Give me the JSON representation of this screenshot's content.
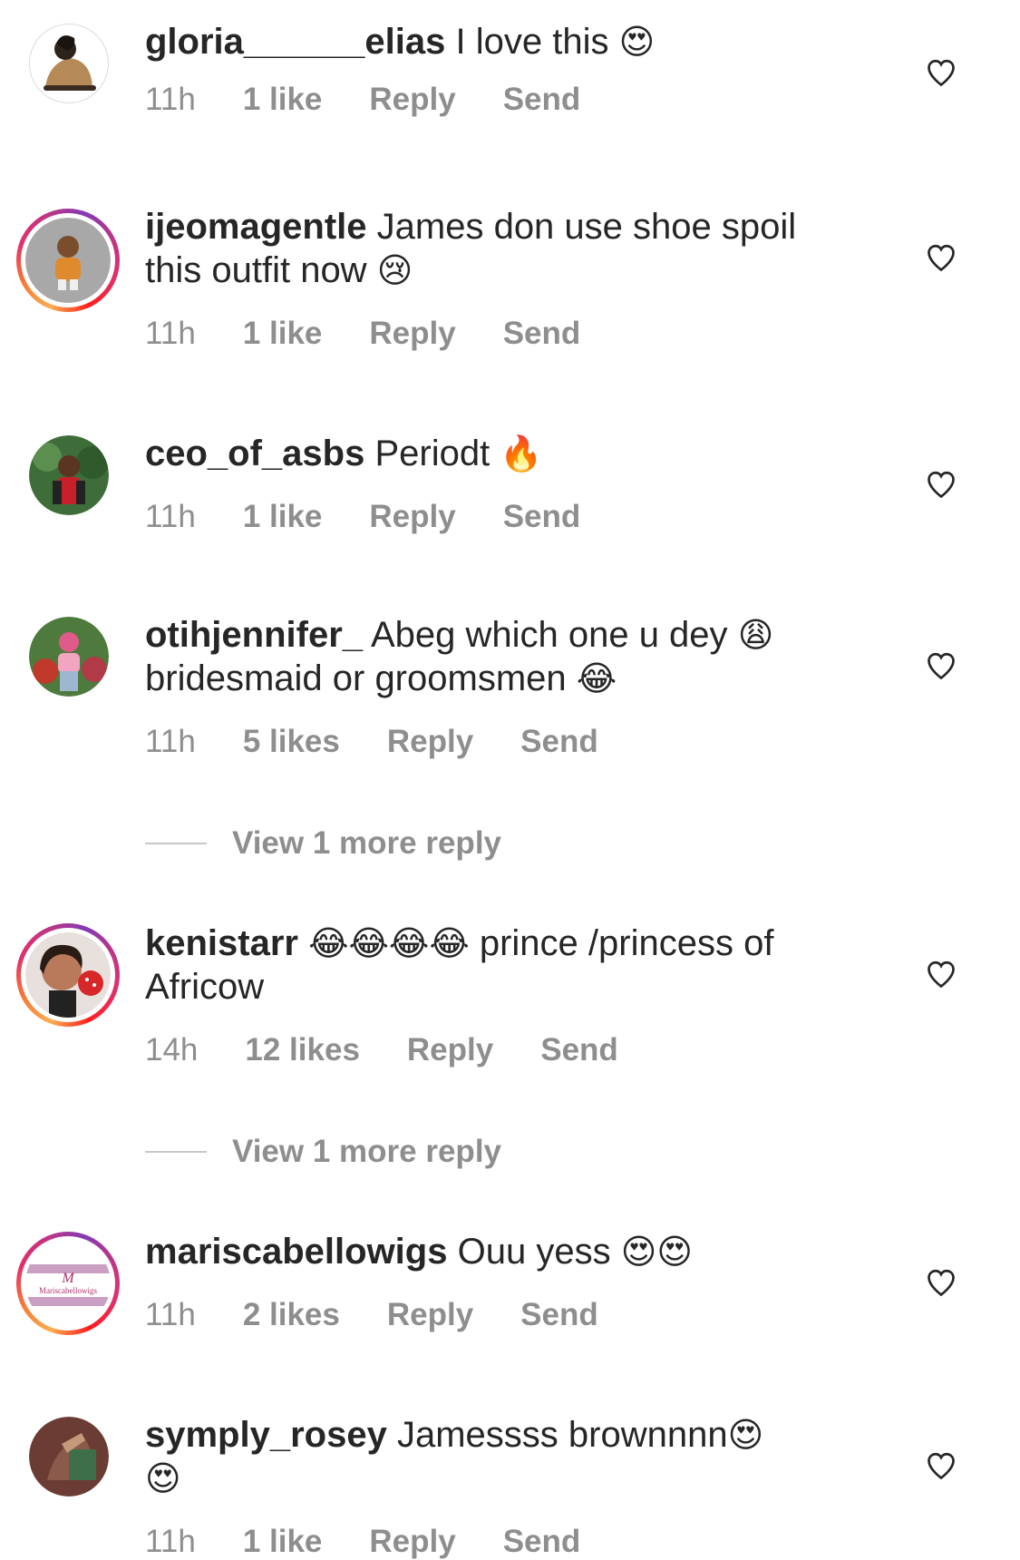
{
  "comments": [
    {
      "username": "gloria______elias",
      "text": "I love this",
      "emoji": "😍",
      "time": "11h",
      "likes": "1 like",
      "reply": "Reply",
      "send": "Send"
    },
    {
      "username": "ijeomagentle",
      "text": "James don use shoe spoil this outfit now",
      "emoji": "😢",
      "time": "11h",
      "likes": "1 like",
      "reply": "Reply",
      "send": "Send"
    },
    {
      "username": "ceo_of_asbs",
      "text": "Periodt",
      "emoji": "🔥",
      "time": "11h",
      "likes": "1 like",
      "reply": "Reply",
      "send": "Send"
    },
    {
      "username": "otihjennifer_",
      "text": "Abeg which one u dey",
      "emoji": "😩",
      "text2": "bridesmaid or groomsmen",
      "emoji2": "😂",
      "time": "11h",
      "likes": "5 likes",
      "reply": "Reply",
      "send": "Send",
      "view_more": "View 1 more reply"
    },
    {
      "username": "kenistarr",
      "emoji": "😂😂😂😂",
      "text": "prince /princess of Africow",
      "time": "14h",
      "likes": "12 likes",
      "reply": "Reply",
      "send": "Send",
      "view_more": "View 1 more reply"
    },
    {
      "username": "mariscabellowigs",
      "text": "Ouu yess",
      "emoji": "😍😍",
      "time": "11h",
      "likes": "2 likes",
      "reply": "Reply",
      "send": "Send",
      "avatar_logo_text": "Mariscabellowigs"
    },
    {
      "username": "symply_rosey",
      "text": "Jamessss brownnnn",
      "emoji": "😍",
      "emoji2": "😍",
      "time": "11h",
      "likes": "1 like",
      "reply": "Reply",
      "send": "Send"
    }
  ],
  "icons": {
    "like": "heart-outline-icon"
  },
  "colors": {
    "meta": "#8e8e8e",
    "text": "#262626",
    "story_ring": "#e1306c"
  }
}
